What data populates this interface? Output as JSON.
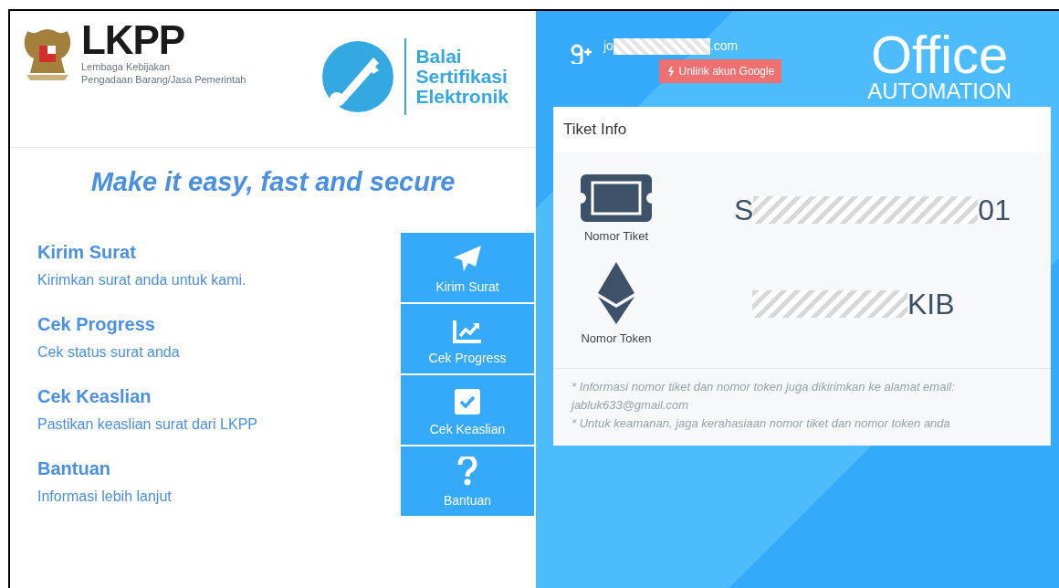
{
  "logos": {
    "lkpp": {
      "name": "LKPP",
      "subtitle_1": "Lembaga Kebijakan",
      "subtitle_2": "Pengadaan Barang/Jasa Pemerintah"
    },
    "bse": {
      "line_1": "Balai",
      "line_2": "Sertifikasi",
      "line_3": "Elektronik"
    }
  },
  "tagline": "Make it easy, fast and secure",
  "features": [
    {
      "title": "Kirim Surat",
      "description": "Kirimkan surat anda untuk kami.",
      "button": "Kirim Surat",
      "kind": "send"
    },
    {
      "title": "Cek Progress",
      "description": "Cek status surat anda",
      "button": "Cek Progress",
      "kind": "chart"
    },
    {
      "title": "Cek Keaslian",
      "description": "Pastikan keaslian surat dari LKPP",
      "button": "Cek Keaslian",
      "kind": "check"
    },
    {
      "title": "Bantuan",
      "description": "Informasi lebih lanjut",
      "button": "Bantuan",
      "kind": "help"
    }
  ],
  "account": {
    "email_start": "jo",
    "email_end": ".com",
    "unlink_button": "Unlink akun Google"
  },
  "brand": {
    "title": "Office",
    "subtitle": "AUTOMATION"
  },
  "ticket_card": {
    "title": "Tiket Info",
    "items": [
      {
        "label": "Nomor Tiket",
        "value_start": "S",
        "value_end": "01",
        "kind": "ticket"
      },
      {
        "label": "Nomor Token",
        "value_end": "KIB",
        "kind": "token"
      }
    ],
    "note_1": "* Informasi nomor tiket dan nomor token juga dikirimkan ke alamat email:",
    "note_email": "jabluk633@gmail.com",
    "note_2": "* Untuk keamanan, jaga kerahasiaan nomor tiket dan nomor token anda"
  }
}
